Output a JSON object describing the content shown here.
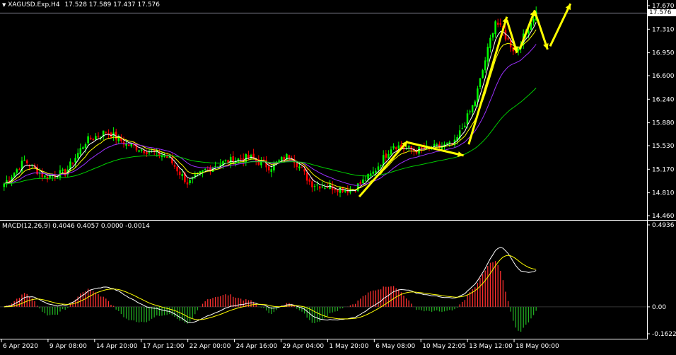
{
  "chart_header": {
    "collapse_glyph": "▼",
    "symbol": "XAGUSD.Exp,H4",
    "ohlc": "17.528 17.589 17.437 17.576"
  },
  "macd_header": {
    "label": "MACD(12,26,9) 0.4046 0.4057 0.0000 -0.0014"
  },
  "current_price": "17.576",
  "colors": {
    "background": "#000000",
    "bull": "#00ff00",
    "bear": "#ff0000",
    "ma_fast": "#ffffff",
    "ma_mid": "#ffff00",
    "ma_slow": "#9b30ff",
    "ma_long": "#00cc00",
    "arrow": "#ffff00",
    "macd_line": "#ffffff",
    "signal_line": "#ffff00"
  },
  "chart_data": [
    {
      "type": "candlestick",
      "title": "XAGUSD.Exp,H4",
      "y_ticks": [
        "17.670",
        "17.310",
        "16.950",
        "16.600",
        "16.240",
        "15.880",
        "15.530",
        "15.170",
        "14.810",
        "14.460"
      ],
      "ylim": [
        14.46,
        17.67
      ],
      "x_ticks": [
        "6 Apr 2020",
        "9 Apr 08:00",
        "14 Apr 20:00",
        "17 Apr 12:00",
        "22 Apr 00:00",
        "24 Apr 16:00",
        "29 Apr 04:00",
        "1 May 20:00",
        "6 May 08:00",
        "10 May 22:05",
        "13 May 12:00",
        "18 May 00:00"
      ],
      "close_path": [
        14.95,
        15.3,
        15.05,
        15.12,
        15.6,
        15.75,
        15.55,
        15.45,
        15.35,
        14.95,
        15.2,
        15.3,
        15.35,
        15.2,
        15.4,
        14.95,
        14.9,
        14.85,
        15.1,
        15.55,
        15.45,
        15.5,
        15.55,
        16.2,
        17.45,
        16.95,
        17.58
      ],
      "moving_averages": [
        "white",
        "yellow",
        "purple",
        "green"
      ],
      "annotations": "yellow arrows tracing the trend"
    },
    {
      "type": "bar",
      "title": "MACD(12,26,9)",
      "y_ticks": [
        "0.4936",
        "0.00",
        "-0.1622"
      ],
      "ylim": [
        -0.1622,
        0.4936
      ],
      "series_names": [
        "MACD",
        "Signal"
      ]
    }
  ]
}
